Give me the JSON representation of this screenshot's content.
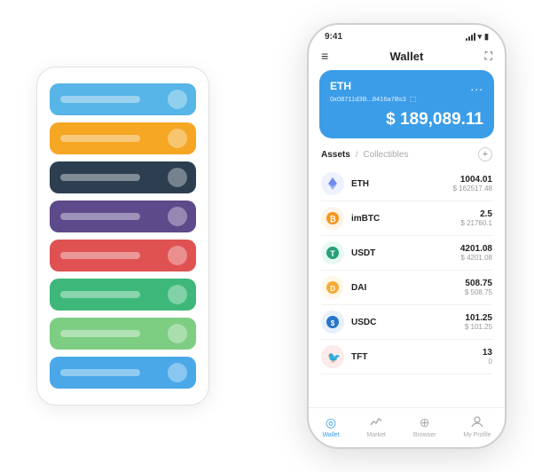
{
  "scene": {
    "back_cards": [
      {
        "color": "blue",
        "text": ""
      },
      {
        "color": "orange",
        "text": ""
      },
      {
        "color": "dark",
        "text": ""
      },
      {
        "color": "purple",
        "text": ""
      },
      {
        "color": "red",
        "text": ""
      },
      {
        "color": "green",
        "text": ""
      },
      {
        "color": "light-green",
        "text": ""
      },
      {
        "color": "light-blue",
        "text": ""
      }
    ]
  },
  "phone": {
    "status_time": "9:41",
    "header_title": "Wallet",
    "eth_card": {
      "label": "ETH",
      "address": "0x08711d3B...8416a7Bs3",
      "copy_icon": "⬚",
      "more_icon": "...",
      "amount": "$ 189,089.11"
    },
    "assets_tab": "Assets",
    "collectibles_tab": "Collectibles",
    "assets": [
      {
        "symbol": "ETH",
        "icon": "♦",
        "icon_color": "#627eea",
        "amount": "1004.01",
        "usd": "$ 162517.48"
      },
      {
        "symbol": "imBTC",
        "icon": "⊙",
        "icon_color": "#f7931a",
        "amount": "2.5",
        "usd": "$ 21760.1"
      },
      {
        "symbol": "USDT",
        "icon": "T",
        "icon_color": "#26a17b",
        "amount": "4201.08",
        "usd": "$ 4201.08"
      },
      {
        "symbol": "DAI",
        "icon": "◈",
        "icon_color": "#f5ac37",
        "amount": "508.75",
        "usd": "$ 508.75"
      },
      {
        "symbol": "USDC",
        "icon": "$",
        "icon_color": "#2775ca",
        "amount": "101.25",
        "usd": "$ 101.25"
      },
      {
        "symbol": "TFT",
        "icon": "✦",
        "icon_color": "#e05a5a",
        "amount": "13",
        "usd": "0"
      }
    ],
    "nav": [
      {
        "label": "Wallet",
        "active": true,
        "icon": "◎"
      },
      {
        "label": "Market",
        "active": false,
        "icon": "📈"
      },
      {
        "label": "Browser",
        "active": false,
        "icon": "⊕"
      },
      {
        "label": "My Profile",
        "active": false,
        "icon": "👤"
      }
    ]
  }
}
